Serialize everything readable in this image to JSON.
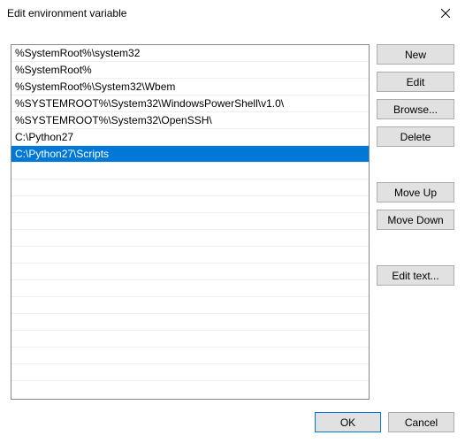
{
  "window": {
    "title": "Edit environment variable"
  },
  "list": {
    "items": [
      "%SystemRoot%\\system32",
      "%SystemRoot%",
      "%SystemRoot%\\System32\\Wbem",
      "%SYSTEMROOT%\\System32\\WindowsPowerShell\\v1.0\\",
      "%SYSTEMROOT%\\System32\\OpenSSH\\",
      "C:\\Python27",
      "C:\\Python27\\Scripts"
    ],
    "selected_index": 6,
    "visible_rows": 20
  },
  "buttons": {
    "new": "New",
    "edit": "Edit",
    "browse": "Browse...",
    "delete": "Delete",
    "move_up": "Move Up",
    "move_down": "Move Down",
    "edit_text": "Edit text...",
    "ok": "OK",
    "cancel": "Cancel"
  }
}
